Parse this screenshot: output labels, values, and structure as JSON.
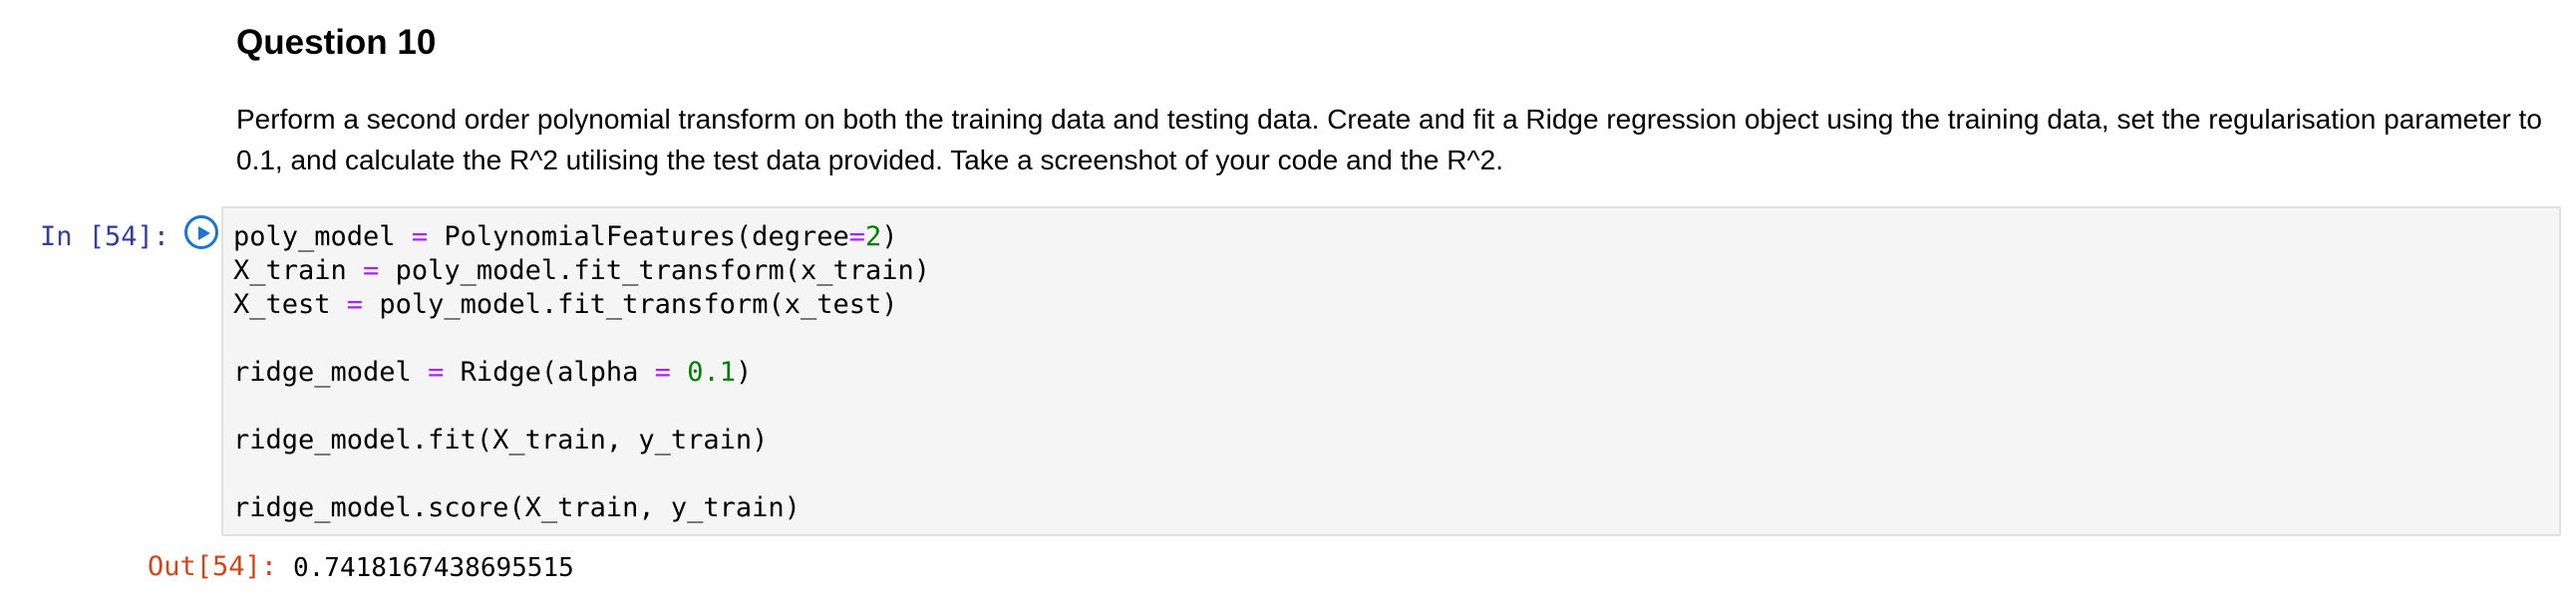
{
  "markdown": {
    "heading": "Question 10",
    "paragraph_line_1": "Perform a second order polynomial transform on both the training data and testing data. Create and fit a Ridge regression object using the training data, set the regularisation parameter to",
    "paragraph_line_2": "0.1, and calculate the R^2 utilising the test data provided. Take a screenshot of your code and the R^2."
  },
  "cell": {
    "in_prompt": "In [54]:",
    "run_icon": "play-circle-icon",
    "code": {
      "l1_a": "poly_model ",
      "l1_op": "=",
      "l1_b": " PolynomialFeatures(degree",
      "l1_op2": "=",
      "l1_num": "2",
      "l1_c": ")",
      "l2_a": "X_train ",
      "l2_op": "=",
      "l2_b": " poly_model.fit_transform(x_train)",
      "l3_a": "X_test ",
      "l3_op": "=",
      "l3_b": " poly_model.fit_transform(x_test)",
      "l5_a": "ridge_model ",
      "l5_op": "=",
      "l5_b": " Ridge(alpha ",
      "l5_op2": "=",
      "l5_sp": " ",
      "l5_num": "0.1",
      "l5_c": ")",
      "l7": "ridge_model.fit(X_train, y_train)",
      "l9": "ridge_model.score(X_train, y_train)"
    },
    "out_prompt": "Out[54]:",
    "output_value": "0.7418167438695515"
  },
  "colors": {
    "in_prompt": "#303f9f",
    "out_prompt": "#d84315",
    "operator": "#aa22ff",
    "number": "#008000",
    "run_button": "#1976d2",
    "code_background": "#f5f5f5"
  }
}
